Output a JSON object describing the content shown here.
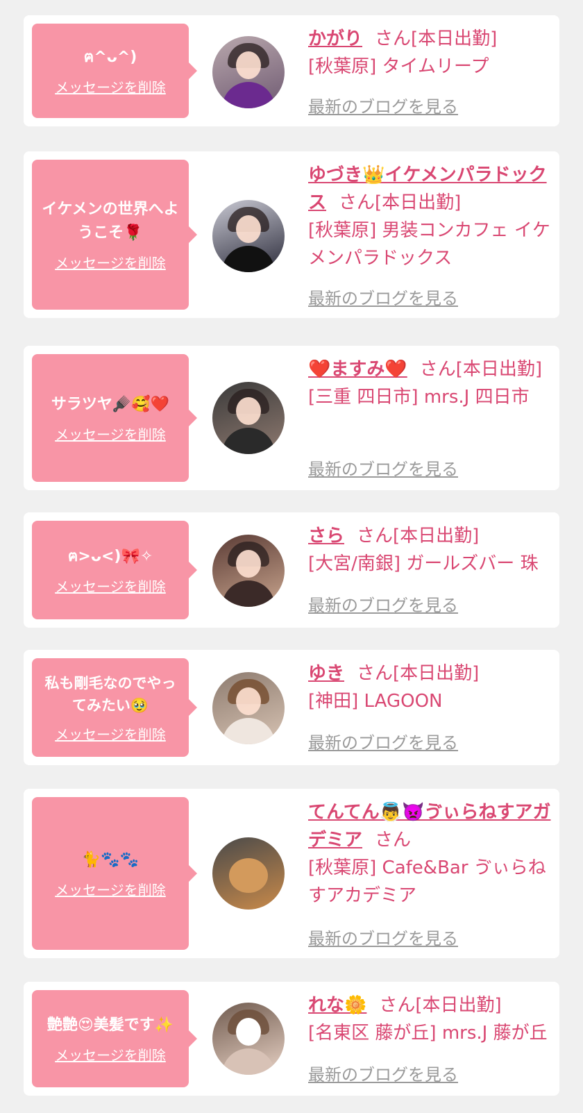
{
  "delete_label": "メッセージを削除",
  "blog_label": "最新のブログを見る",
  "san_label": "さん",
  "colors": {
    "accent": "#d94772",
    "bubble": "#f895a6",
    "background": "#f0f0f0"
  },
  "cards": [
    {
      "message": "ฅ^ᴗ^)",
      "name": "かがり",
      "attendance": "[本日出勤]",
      "shop": "[秋葉原] タイムリープ",
      "avatar_icon": "avatar-photo"
    },
    {
      "message": "イケメンの世界へようこそ🌹",
      "name": "ゆづき👑イケメンパラドックス",
      "attendance": "[本日出勤]",
      "shop": "[秋葉原] 男装コンカフェ イケメンパラドックス",
      "avatar_icon": "avatar-photo"
    },
    {
      "message": "サラツヤ🪮🥰❤️",
      "name": "❤️ますみ❤️",
      "attendance": "[本日出勤]",
      "shop": "[三重 四日市] mrs.J 四日市",
      "avatar_icon": "avatar-photo"
    },
    {
      "message": "ฅ>ᴗ<)🎀✧",
      "name": "さら",
      "attendance": "[本日出勤]",
      "shop": "[大宮/南銀] ガールズバー 珠",
      "avatar_icon": "avatar-photo"
    },
    {
      "message": "私も剛毛なのでやってみたい🥹",
      "name": "ゆき",
      "attendance": "[本日出勤]",
      "shop": "[神田] LAGOON",
      "avatar_icon": "avatar-photo"
    },
    {
      "message": "🐈🐾🐾",
      "name": "てんてん👼👿ゔぃらねすアガデミア",
      "attendance": "",
      "shop": "[秋葉原] Cafe&Bar ゔぃらねすアカデミア",
      "avatar_icon": "avatar-photo"
    },
    {
      "message": "艶艶😍美髪です✨",
      "name": "れな🌼",
      "attendance": "[本日出勤]",
      "shop": "[名東区 藤が丘] mrs.J 藤が丘",
      "avatar_icon": "avatar-photo"
    }
  ]
}
